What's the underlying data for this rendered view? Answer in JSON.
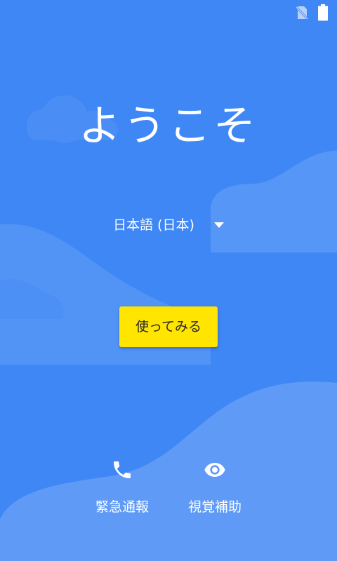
{
  "status_bar": {
    "icons": [
      "no-sim-icon",
      "battery-icon"
    ]
  },
  "welcome": {
    "title": "ようこそ"
  },
  "language": {
    "selected": "日本語 (日本)",
    "icon": "dropdown-arrow-icon"
  },
  "start_button": {
    "label": "使ってみる",
    "color": "#ffe500"
  },
  "bottom_actions": {
    "emergency": {
      "label": "緊急通報",
      "icon": "phone-icon"
    },
    "vision": {
      "label": "視覚補助",
      "icon": "eye-icon"
    }
  },
  "colors": {
    "background": "#3f87f5",
    "wave": "#5c98f6",
    "text": "#ffffff"
  }
}
